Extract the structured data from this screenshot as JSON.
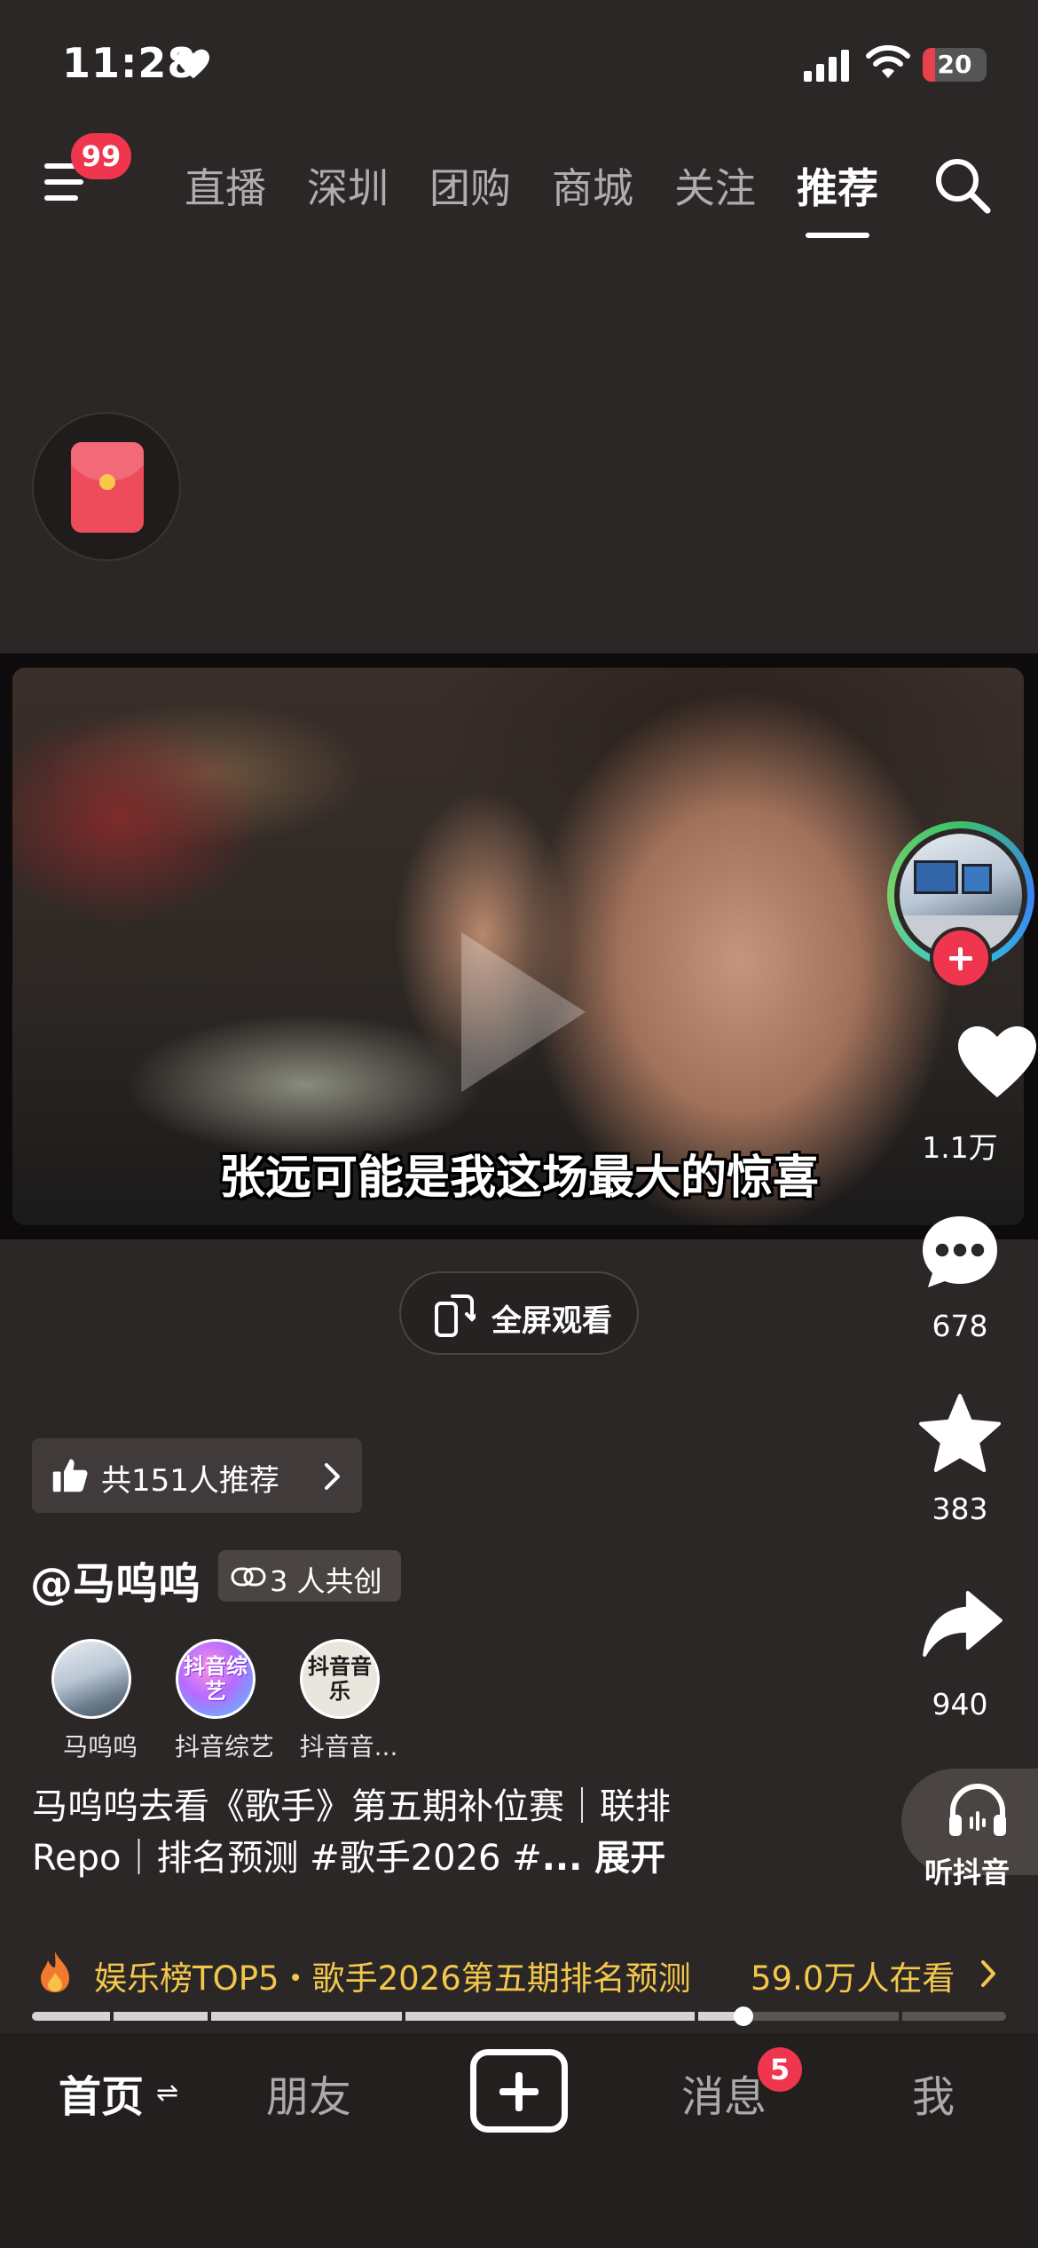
{
  "status_bar": {
    "time": "11:28",
    "battery": "20",
    "battery_level": 0.2,
    "icons": [
      "heart-icon",
      "signal-icon",
      "wifi-icon",
      "battery-icon"
    ]
  },
  "top_nav": {
    "menu_badge": "99",
    "tabs": [
      "直播",
      "深圳",
      "团购",
      "商城",
      "关注",
      "推荐"
    ],
    "active_tab": "推荐"
  },
  "video": {
    "subtitle": "张远可能是我这场最大的惊喜",
    "fullscreen_label": "全屏观看"
  },
  "actions": {
    "likes": "1.1万",
    "comments": "678",
    "favorites": "383",
    "shares": "940",
    "listen_label": "听抖音"
  },
  "recommend": {
    "label": "共151人推荐"
  },
  "author": {
    "name": "@马呜呜",
    "cocreate_label": "3 人共创",
    "coauthors": [
      {
        "name": "马呜呜"
      },
      {
        "name": "抖音综艺",
        "logo_text": "抖音综艺"
      },
      {
        "name": "抖音音...",
        "logo_text": "抖音音乐"
      }
    ]
  },
  "caption": {
    "line1": "马呜呜去看《歌手》第五期补位赛｜联排",
    "line2": "Repo｜排名预测 #歌手2026 #",
    "more": "... 展开"
  },
  "hot_bar": {
    "title": "娱乐榜TOP5・歌手2026第五期排名预测",
    "count": "59.0万人在看"
  },
  "progress": {
    "value": 0.73,
    "segments": [
      0.08,
      0.18,
      0.38,
      0.68,
      0.89
    ]
  },
  "bottom_nav": {
    "home": "首页",
    "refresh": "⇌",
    "friends": "朋友",
    "messages": "消息",
    "messages_badge": "5",
    "me": "我"
  },
  "colors": {
    "background": "#2b2726",
    "accent_red": "#f0364e",
    "hot_yellow": "#f3c64c"
  }
}
